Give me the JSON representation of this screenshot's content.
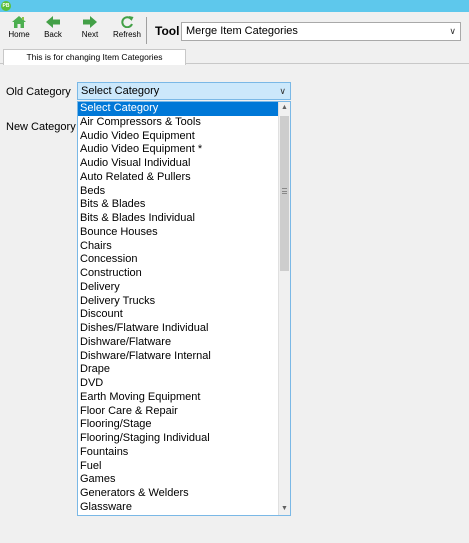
{
  "app": {
    "logo_text": "PB"
  },
  "toolbar": {
    "home_label": "Home",
    "back_label": "Back",
    "next_label": "Next",
    "refresh_label": "Refresh",
    "tool_label": "Tool",
    "tool_value": "Merge Item Categories"
  },
  "tabs": [
    {
      "label": "This is for changing Item Categories"
    }
  ],
  "form": {
    "old_category_label": "Old Category",
    "old_category_value": "Select Category",
    "new_category_label": "New Category"
  },
  "dropdown": {
    "items": [
      "Select Category",
      "Air Compressors & Tools",
      "Audio Video Equipment",
      "Audio Video Equipment *",
      "Audio Visual Individual",
      "Auto Related & Pullers",
      "Beds",
      "Bits & Blades",
      "Bits & Blades Individual",
      "Bounce Houses",
      "Chairs",
      "Concession",
      "Construction",
      "Delivery",
      "Delivery Trucks",
      "Discount",
      "Dishes/Flatware Individual",
      "Dishware/Flatware",
      "Dishware/Flatware Internal",
      "Drape",
      "DVD",
      "Earth Moving Equipment",
      "Floor Care & Repair",
      "Flooring/Stage",
      "Flooring/Staging Individual",
      "Fountains",
      "Fuel",
      "Games",
      "Generators & Welders",
      "Glassware"
    ],
    "selected_index": 0
  },
  "colors": {
    "titlebar": "#5ec8ec",
    "selection": "#0078d7",
    "combo_focus": "#cce8fb"
  }
}
